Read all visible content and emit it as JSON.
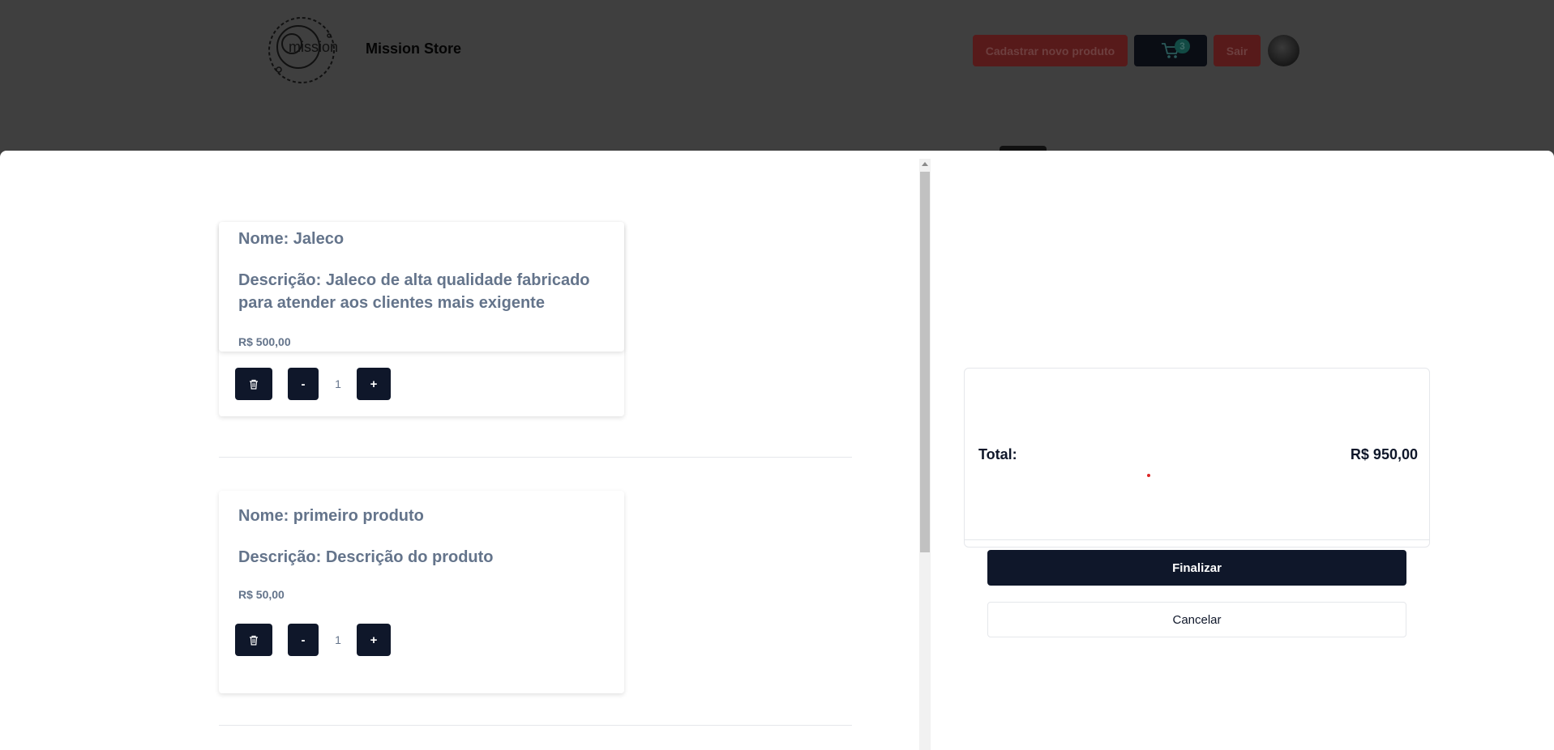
{
  "header": {
    "logo_text": "mission",
    "store_name": "Mission Store",
    "new_product_label": "Cadastrar novo produto",
    "cart_count": "3",
    "logout_label": "Sair"
  },
  "cart": {
    "items": [
      {
        "name": "Nome: Jaleco",
        "description": "Descrição: Jaleco de alta qualidade fabricado para atender aos clientes mais exigente",
        "price": "R$ 500,00",
        "quantity": "1",
        "minus_label": "-",
        "plus_label": "+"
      },
      {
        "name": "Nome: primeiro produto",
        "description": "Descrição: Descrição do produto",
        "price": "R$ 50,00",
        "quantity": "1",
        "minus_label": "-",
        "plus_label": "+"
      }
    ],
    "summary": {
      "total_label": "Total:",
      "total_value": "R$ 950,00",
      "finish_label": "Finalizar",
      "cancel_label": "Cancelar"
    }
  }
}
